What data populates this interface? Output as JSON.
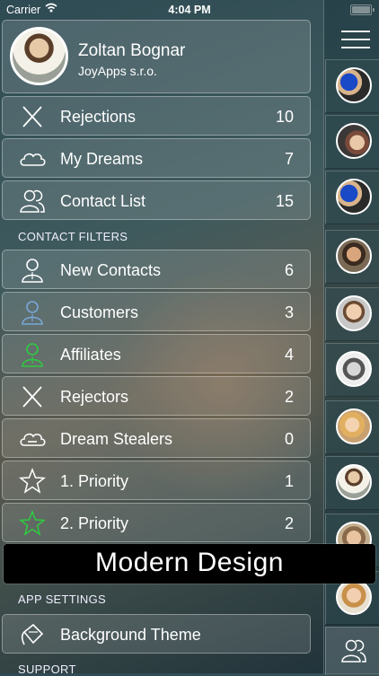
{
  "status_bar": {
    "carrier": "Carrier",
    "time": "4:04 PM"
  },
  "profile": {
    "name": "Zoltan Bognar",
    "company": "JoyApps s.r.o."
  },
  "main_menu": [
    {
      "label": "Rejections",
      "count": "10",
      "icon": "x-icon"
    },
    {
      "label": "My Dreams",
      "count": "7",
      "icon": "cloud-icon"
    },
    {
      "label": "Contact List",
      "count": "15",
      "icon": "people-icon"
    }
  ],
  "filters_header": "CONTACT FILTERS",
  "filters": [
    {
      "label": "New Contacts",
      "count": "6",
      "icon": "person-icon",
      "color": "#ffffff"
    },
    {
      "label": "Customers",
      "count": "3",
      "icon": "person-icon",
      "color": "#7aa7d8"
    },
    {
      "label": "Affiliates",
      "count": "4",
      "icon": "person-icon",
      "color": "#2ecc40"
    },
    {
      "label": "Rejectors",
      "count": "2",
      "icon": "x-icon",
      "color": "#ffffff"
    },
    {
      "label": "Dream Stealers",
      "count": "0",
      "icon": "cloud-minus-icon",
      "color": "#ffffff"
    },
    {
      "label": "1. Priority",
      "count": "1",
      "icon": "star-icon",
      "color": "#ffffff"
    },
    {
      "label": "2. Priority",
      "count": "2",
      "icon": "star-icon",
      "color": "#2ecc40"
    }
  ],
  "banner": "Modern Design",
  "app_settings_header": "APP SETTINGS",
  "settings": [
    {
      "label": "Background Theme",
      "icon": "paint-bucket-icon"
    }
  ],
  "support_header": "SUPPORT",
  "sidebar": {
    "menu_icon": "hamburger-icon",
    "contacts_icon": "people-icon",
    "avatar_count": 10
  }
}
